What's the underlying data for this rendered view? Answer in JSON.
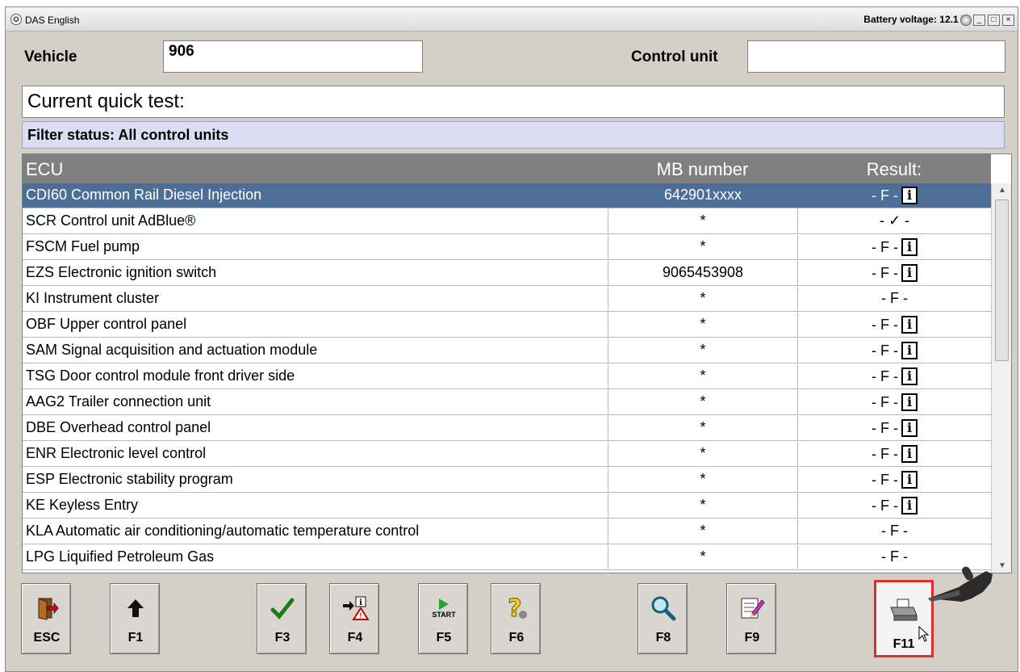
{
  "window": {
    "title": "DAS English",
    "battery_label": "Battery voltage: 12.1 V",
    "controls": [
      "_",
      "□",
      "×"
    ]
  },
  "topbar": {
    "vehicle_label": "Vehicle",
    "vehicle_value": "906",
    "control_unit_label": "Control unit",
    "control_unit_value": ""
  },
  "quick_test_label": "Current quick test:",
  "filter_status": "Filter status: All control units",
  "table": {
    "headers": {
      "ecu": "ECU",
      "mb": "MB number",
      "result": "Result:"
    },
    "rows": [
      {
        "ecu": "CDI60 Common Rail Diesel Injection",
        "mb": "642901xxxx",
        "result": "- F -",
        "info": true,
        "selected": true
      },
      {
        "ecu": "SCR Control unit AdBlue®",
        "mb": "*",
        "result": "- ✓ -",
        "info": false
      },
      {
        "ecu": "FSCM Fuel pump",
        "mb": "*",
        "result": "- F -",
        "info": true
      },
      {
        "ecu": "EZS Electronic ignition switch",
        "mb": "9065453908",
        "result": "- F -",
        "info": true
      },
      {
        "ecu": "KI Instrument cluster",
        "mb": "*",
        "result": "- F -",
        "info": false
      },
      {
        "ecu": "OBF Upper control panel",
        "mb": "*",
        "result": "- F -",
        "info": true
      },
      {
        "ecu": "SAM Signal acquisition and actuation module",
        "mb": "*",
        "result": "- F -",
        "info": true
      },
      {
        "ecu": "TSG Door control module front driver side",
        "mb": "*",
        "result": "- F -",
        "info": true
      },
      {
        "ecu": "AAG2 Trailer connection unit",
        "mb": "*",
        "result": "- F -",
        "info": true
      },
      {
        "ecu": "DBE Overhead control panel",
        "mb": "*",
        "result": "- F -",
        "info": true
      },
      {
        "ecu": "ENR Electronic level control",
        "mb": "*",
        "result": "- F -",
        "info": true
      },
      {
        "ecu": "ESP Electronic stability program",
        "mb": "*",
        "result": "- F -",
        "info": true
      },
      {
        "ecu": "KE Keyless Entry",
        "mb": "*",
        "result": "- F -",
        "info": true
      },
      {
        "ecu": "KLA Automatic air conditioning/automatic temperature control",
        "mb": "*",
        "result": "- F -",
        "info": false
      },
      {
        "ecu": "LPG Liquified Petroleum Gas",
        "mb": "*",
        "result": "- F -",
        "info": false
      }
    ]
  },
  "fkeys": [
    {
      "label": "ESC",
      "icon": "exit-door-icon"
    },
    {
      "label": "F1",
      "icon": "up-arrow-icon"
    },
    {
      "label": "F3",
      "icon": "checkmark-icon"
    },
    {
      "label": "F4",
      "icon": "info-warning-icon"
    },
    {
      "label": "F5",
      "icon": "start-play-icon",
      "icon_text": "START"
    },
    {
      "label": "F6",
      "icon": "help-question-icon"
    },
    {
      "label": "F8",
      "icon": "magnifier-icon"
    },
    {
      "label": "F9",
      "icon": "edit-document-icon"
    },
    {
      "label": "F11",
      "icon": "printer-icon"
    }
  ],
  "colors": {
    "selected_row": "#4d6f97",
    "header_bg": "#808080",
    "filter_bg": "#dcdcf2",
    "highlight_border": "#e0302c"
  }
}
